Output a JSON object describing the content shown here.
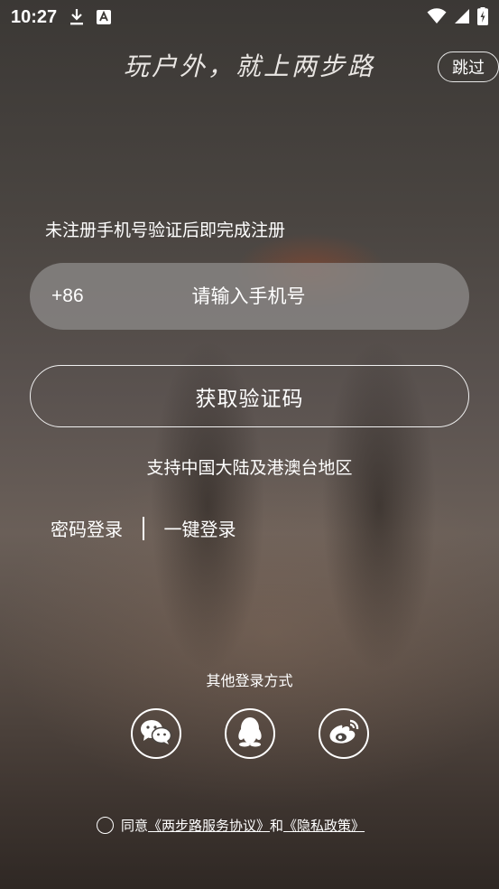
{
  "status_bar": {
    "time": "10:27",
    "left_icons": [
      "download-icon",
      "font-icon"
    ],
    "right_icons": [
      "wifi-icon",
      "signal-icon",
      "battery-charging-icon"
    ]
  },
  "header": {
    "slogan": "玩户外，就上两步路",
    "skip_label": "跳过"
  },
  "form": {
    "hint": "未注册手机号验证后即完成注册",
    "country_code": "+86",
    "phone_placeholder": "请输入手机号",
    "get_code_label": "获取验证码",
    "support_text": "支持中国大陆及港澳台地区"
  },
  "alt_login": {
    "password_login": "密码登录",
    "one_click_login": "一键登录"
  },
  "other_login": {
    "title": "其他登录方式",
    "providers": [
      "wechat-icon",
      "qq-icon",
      "weibo-icon"
    ]
  },
  "agreement": {
    "prefix": "同意",
    "service_link": "《两步路服务协议》",
    "conjunction": "和",
    "privacy_link": "《隐私政策》"
  },
  "colors": {
    "text": "#ffffff",
    "field_bg": "#8c8988"
  }
}
